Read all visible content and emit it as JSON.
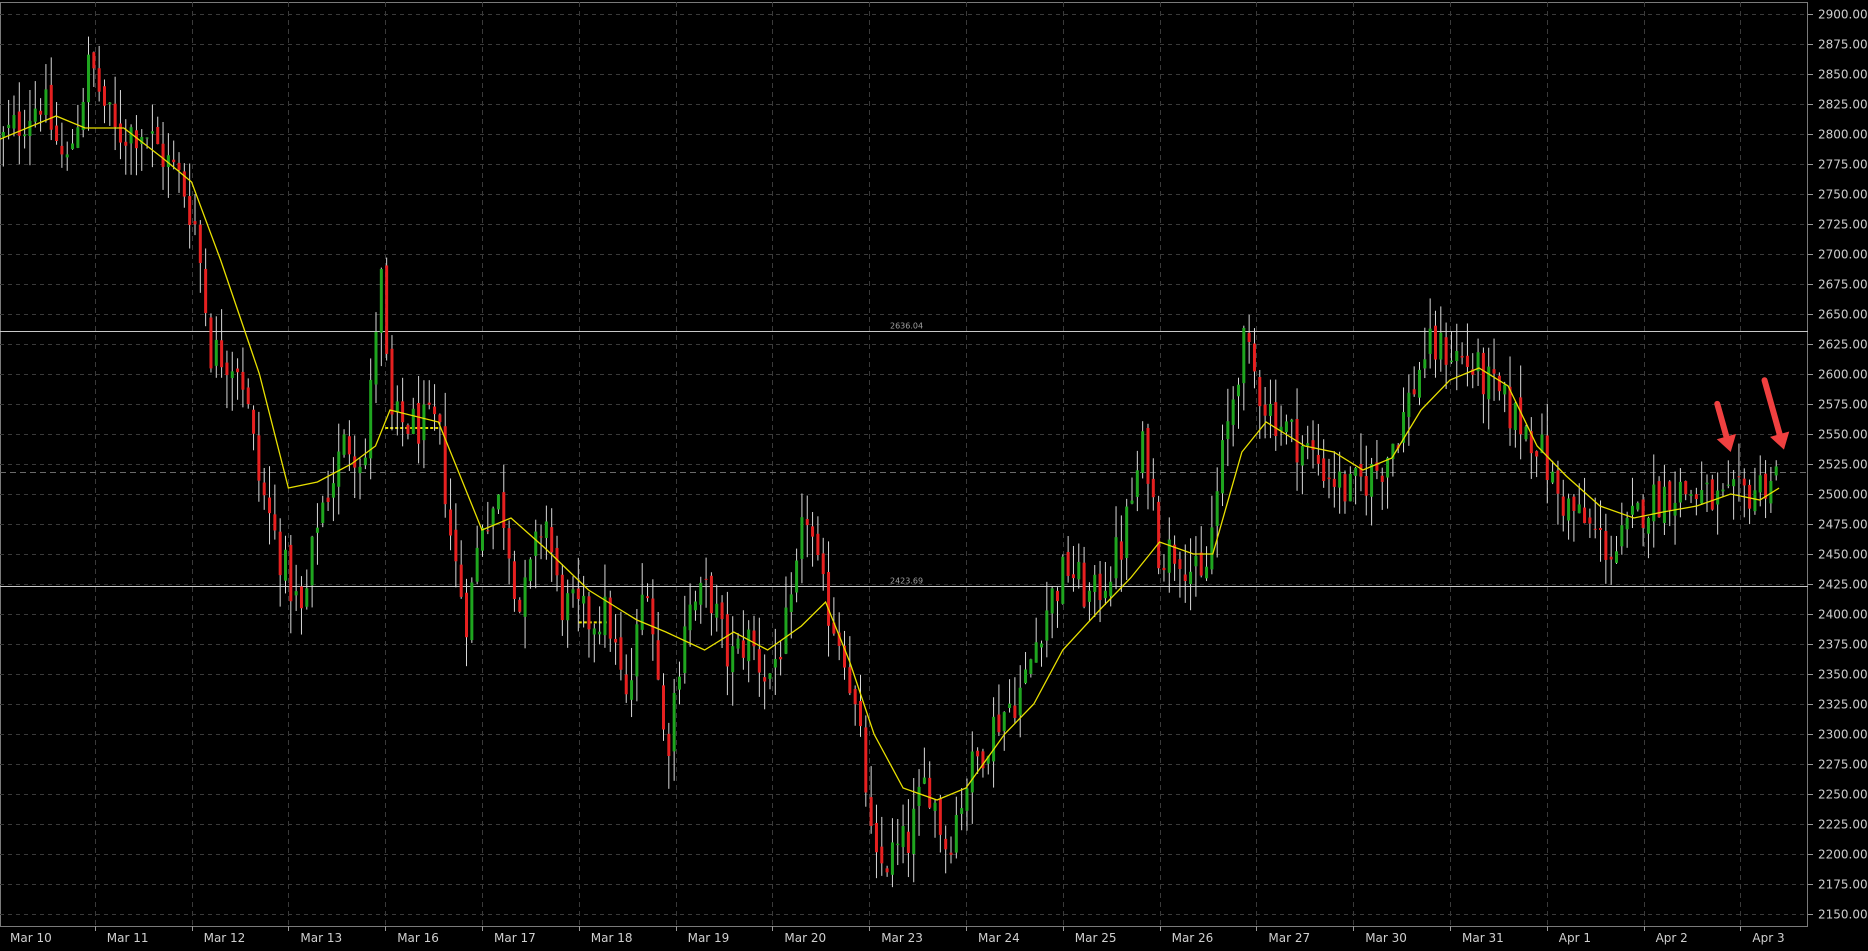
{
  "chart_data": {
    "type": "candlestick",
    "title": "",
    "xlabel": "",
    "ylabel": "",
    "ylim": [
      2140,
      2910
    ],
    "y_ticks": [
      2150,
      2175,
      2200,
      2225,
      2250,
      2275,
      2300,
      2325,
      2350,
      2375,
      2400,
      2425,
      2450,
      2475,
      2500,
      2525,
      2550,
      2575,
      2600,
      2625,
      2650,
      2675,
      2700,
      2725,
      2750,
      2775,
      2800,
      2825,
      2850,
      2875,
      2900
    ],
    "y_tick_labels": [
      "2150.00",
      "2175.00",
      "2200.00",
      "2225.00",
      "2250.00",
      "2275.00",
      "2300.00",
      "2325.00",
      "2350.00",
      "2375.00",
      "2400.00",
      "2425.00",
      "2450.00",
      "2475.00",
      "2500.00",
      "2525.00",
      "2550.00",
      "2575.00",
      "2600.00",
      "2625.00",
      "2650.00",
      "2675.00",
      "2700.00",
      "2725.00",
      "2750.00",
      "2775.00",
      "2800.00",
      "2825.00",
      "2850.00",
      "2875.00",
      "2900.00"
    ],
    "x_categories": [
      "Mar 10",
      "Mar 11",
      "Mar 12",
      "Mar 13",
      "Mar 16",
      "Mar 17",
      "Mar 18",
      "Mar 19",
      "Mar 20",
      "Mar 23",
      "Mar 24",
      "Mar 25",
      "Mar 26",
      "Mar 27",
      "Mar 30",
      "Mar 31",
      "Apr 1",
      "Apr 2",
      "Apr 3"
    ],
    "grid": true,
    "moving_average_color": "#e8e000",
    "up_color": "#1fa51f",
    "down_color": "#e62020",
    "wick_color": "#d8d8d8",
    "price_keypoints": [
      {
        "t": 0.0,
        "v": 2790
      },
      {
        "t": 0.45,
        "v": 2830
      },
      {
        "t": 0.7,
        "v": 2770
      },
      {
        "t": 0.95,
        "v": 2860
      },
      {
        "t": 1.2,
        "v": 2800
      },
      {
        "t": 1.5,
        "v": 2805
      },
      {
        "t": 1.9,
        "v": 2760
      },
      {
        "t": 2.05,
        "v": 2720
      },
      {
        "t": 2.2,
        "v": 2620
      },
      {
        "t": 2.5,
        "v": 2610
      },
      {
        "t": 2.7,
        "v": 2510
      },
      {
        "t": 2.95,
        "v": 2440
      },
      {
        "t": 3.15,
        "v": 2395
      },
      {
        "t": 3.3,
        "v": 2480
      },
      {
        "t": 3.6,
        "v": 2545
      },
      {
        "t": 3.8,
        "v": 2530
      },
      {
        "t": 3.95,
        "v": 2690
      },
      {
        "t": 4.05,
        "v": 2560
      },
      {
        "t": 4.55,
        "v": 2555
      },
      {
        "t": 4.7,
        "v": 2450
      },
      {
        "t": 4.85,
        "v": 2395
      },
      {
        "t": 5.0,
        "v": 2480
      },
      {
        "t": 5.2,
        "v": 2495
      },
      {
        "t": 5.4,
        "v": 2400
      },
      {
        "t": 5.65,
        "v": 2485
      },
      {
        "t": 5.8,
        "v": 2410
      },
      {
        "t": 6.1,
        "v": 2395
      },
      {
        "t": 6.3,
        "v": 2400
      },
      {
        "t": 6.5,
        "v": 2320
      },
      {
        "t": 6.7,
        "v": 2440
      },
      {
        "t": 6.9,
        "v": 2280
      },
      {
        "t": 7.1,
        "v": 2400
      },
      {
        "t": 7.35,
        "v": 2420
      },
      {
        "t": 7.55,
        "v": 2360
      },
      {
        "t": 7.75,
        "v": 2380
      },
      {
        "t": 7.95,
        "v": 2345
      },
      {
        "t": 8.2,
        "v": 2400
      },
      {
        "t": 8.35,
        "v": 2490
      },
      {
        "t": 8.5,
        "v": 2420
      },
      {
        "t": 8.75,
        "v": 2370
      },
      {
        "t": 8.95,
        "v": 2270
      },
      {
        "t": 9.05,
        "v": 2185
      },
      {
        "t": 9.4,
        "v": 2210
      },
      {
        "t": 9.6,
        "v": 2265
      },
      {
        "t": 9.8,
        "v": 2205
      },
      {
        "t": 10.0,
        "v": 2260
      },
      {
        "t": 10.3,
        "v": 2310
      },
      {
        "t": 10.6,
        "v": 2340
      },
      {
        "t": 10.8,
        "v": 2400
      },
      {
        "t": 11.05,
        "v": 2440
      },
      {
        "t": 11.3,
        "v": 2410
      },
      {
        "t": 11.6,
        "v": 2455
      },
      {
        "t": 11.85,
        "v": 2545
      },
      {
        "t": 12.0,
        "v": 2450
      },
      {
        "t": 12.2,
        "v": 2455
      },
      {
        "t": 12.45,
        "v": 2420
      },
      {
        "t": 12.65,
        "v": 2530
      },
      {
        "t": 12.85,
        "v": 2625
      },
      {
        "t": 13.1,
        "v": 2575
      },
      {
        "t": 13.3,
        "v": 2555
      },
      {
        "t": 13.6,
        "v": 2530
      },
      {
        "t": 13.95,
        "v": 2500
      },
      {
        "t": 14.3,
        "v": 2525
      },
      {
        "t": 14.5,
        "v": 2560
      },
      {
        "t": 14.75,
        "v": 2620
      },
      {
        "t": 15.0,
        "v": 2620
      },
      {
        "t": 15.3,
        "v": 2600
      },
      {
        "t": 15.6,
        "v": 2570
      },
      {
        "t": 15.9,
        "v": 2545
      },
      {
        "t": 16.1,
        "v": 2500
      },
      {
        "t": 16.45,
        "v": 2470
      },
      {
        "t": 16.7,
        "v": 2450
      },
      {
        "t": 17.0,
        "v": 2490
      },
      {
        "t": 17.3,
        "v": 2505
      },
      {
        "t": 17.55,
        "v": 2500
      },
      {
        "t": 17.85,
        "v": 2490
      },
      {
        "t": 18.15,
        "v": 2505
      },
      {
        "t": 18.4,
        "v": 2520
      }
    ],
    "moving_average": [
      {
        "t": 0.0,
        "v": 2795
      },
      {
        "t": 0.6,
        "v": 2815
      },
      {
        "t": 0.9,
        "v": 2805
      },
      {
        "t": 1.3,
        "v": 2805
      },
      {
        "t": 1.7,
        "v": 2780
      },
      {
        "t": 2.0,
        "v": 2760
      },
      {
        "t": 2.3,
        "v": 2695
      },
      {
        "t": 2.7,
        "v": 2600
      },
      {
        "t": 3.0,
        "v": 2505
      },
      {
        "t": 3.3,
        "v": 2510
      },
      {
        "t": 3.65,
        "v": 2525
      },
      {
        "t": 3.9,
        "v": 2540
      },
      {
        "t": 4.05,
        "v": 2570
      },
      {
        "t": 4.55,
        "v": 2560
      },
      {
        "t": 4.75,
        "v": 2520
      },
      {
        "t": 5.0,
        "v": 2470
      },
      {
        "t": 5.3,
        "v": 2480
      },
      {
        "t": 5.65,
        "v": 2455
      },
      {
        "t": 6.1,
        "v": 2420
      },
      {
        "t": 6.4,
        "v": 2405
      },
      {
        "t": 6.6,
        "v": 2395
      },
      {
        "t": 6.9,
        "v": 2385
      },
      {
        "t": 7.3,
        "v": 2370
      },
      {
        "t": 7.6,
        "v": 2385
      },
      {
        "t": 7.95,
        "v": 2370
      },
      {
        "t": 8.3,
        "v": 2390
      },
      {
        "t": 8.55,
        "v": 2410
      },
      {
        "t": 8.8,
        "v": 2360
      },
      {
        "t": 9.05,
        "v": 2300
      },
      {
        "t": 9.35,
        "v": 2255
      },
      {
        "t": 9.7,
        "v": 2245
      },
      {
        "t": 10.0,
        "v": 2255
      },
      {
        "t": 10.4,
        "v": 2300
      },
      {
        "t": 10.7,
        "v": 2325
      },
      {
        "t": 11.0,
        "v": 2370
      },
      {
        "t": 11.4,
        "v": 2405
      },
      {
        "t": 11.7,
        "v": 2430
      },
      {
        "t": 12.0,
        "v": 2460
      },
      {
        "t": 12.35,
        "v": 2450
      },
      {
        "t": 12.55,
        "v": 2450
      },
      {
        "t": 12.85,
        "v": 2535
      },
      {
        "t": 13.1,
        "v": 2560
      },
      {
        "t": 13.5,
        "v": 2540
      },
      {
        "t": 13.8,
        "v": 2535
      },
      {
        "t": 14.1,
        "v": 2520
      },
      {
        "t": 14.4,
        "v": 2530
      },
      {
        "t": 14.7,
        "v": 2570
      },
      {
        "t": 15.0,
        "v": 2595
      },
      {
        "t": 15.3,
        "v": 2605
      },
      {
        "t": 15.6,
        "v": 2590
      },
      {
        "t": 15.9,
        "v": 2540
      },
      {
        "t": 16.2,
        "v": 2515
      },
      {
        "t": 16.55,
        "v": 2490
      },
      {
        "t": 16.9,
        "v": 2480
      },
      {
        "t": 17.2,
        "v": 2485
      },
      {
        "t": 17.55,
        "v": 2490
      },
      {
        "t": 17.9,
        "v": 2500
      },
      {
        "t": 18.2,
        "v": 2495
      },
      {
        "t": 18.4,
        "v": 2505
      }
    ],
    "horizontal_levels": [
      {
        "label": "2636.04",
        "value": 2636.04
      },
      {
        "label": "2423.69",
        "value": 2423.69
      }
    ],
    "dotted_segments": [
      {
        "t1": 4.0,
        "t2": 4.55,
        "v": 2555
      },
      {
        "t1": 6.0,
        "t2": 6.3,
        "v": 2393
      }
    ],
    "current_price_level": 2518,
    "annotations": [
      {
        "type": "arrow",
        "color": "#f04040",
        "target_t": 17.9,
        "target_v": 2535
      },
      {
        "type": "arrow",
        "color": "#f04040",
        "target_t": 18.45,
        "target_v": 2537
      }
    ]
  }
}
